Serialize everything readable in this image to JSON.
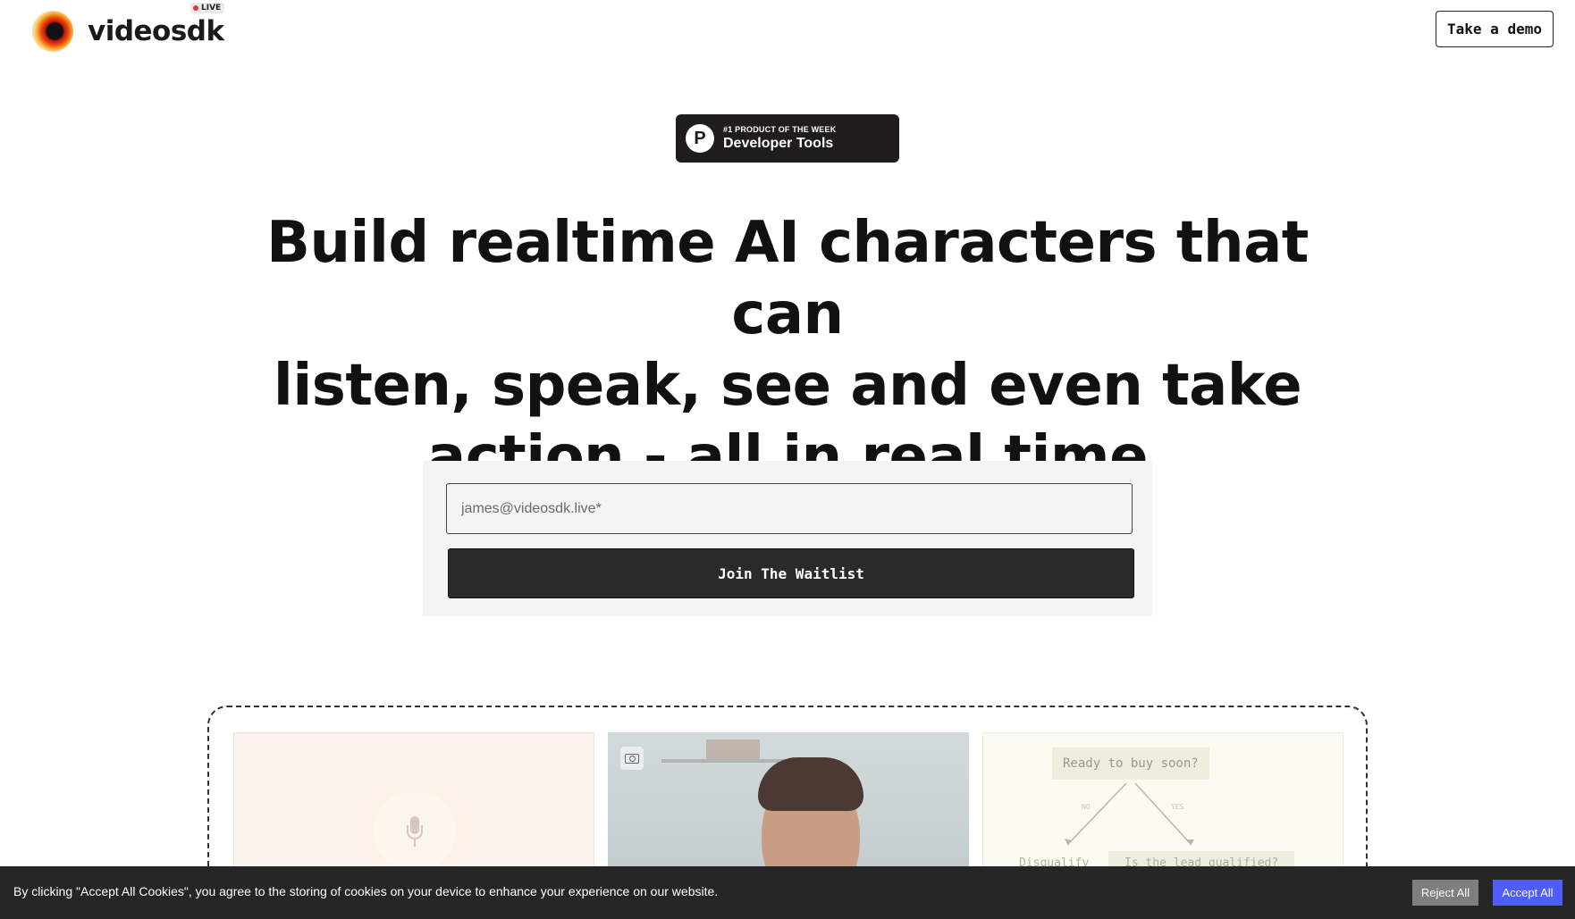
{
  "header": {
    "brand": "videosdk",
    "live_badge": "LIVE",
    "demo_button": "Take a demo"
  },
  "product_hunt": {
    "kicker": "#1 PRODUCT OF THE WEEK",
    "title": "Developer Tools",
    "logo_letter": "P"
  },
  "hero": {
    "line1": "Build realtime AI characters that can",
    "line2": "listen, speak, see and even take",
    "line3": "action - all in real time"
  },
  "waitlist": {
    "email_placeholder": "james@videosdk.live*",
    "email_value": "",
    "submit_label": "Join The Waitlist"
  },
  "preview": {
    "flow_question": "Ready to buy soon?",
    "flow_no": "NO",
    "flow_yes": "YES",
    "flow_left": "Disqualify",
    "flow_right": "Is the lead qualified?"
  },
  "cookie": {
    "message": "By clicking \"Accept All Cookies\", you agree to the storing of cookies on your device to enhance your experience on our website.",
    "reject_label": "Reject All",
    "accept_label": "Accept All"
  },
  "colors": {
    "primary_dark": "#2a2a2a",
    "accept_blue": "#4f5dff",
    "live_red": "#e53935"
  }
}
